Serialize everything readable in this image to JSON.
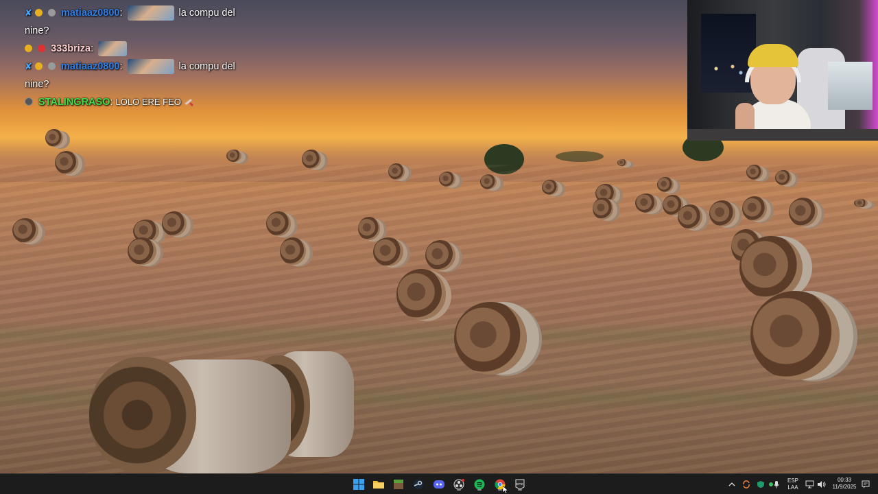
{
  "chat": {
    "lines": [
      {
        "user": "333briza",
        "message": "",
        "user_color": "#ffd0d0"
      },
      {
        "user": "matiaaz0800",
        "message": "la compu del",
        "continuation": "nine?",
        "user_color": "#2f7fe8"
      },
      {
        "user": "333briza",
        "message": "",
        "user_color": "#ffd0d0"
      },
      {
        "user": "matiaaz0800",
        "message": "la compu del",
        "continuation": "nine?",
        "user_color": "#2f7fe8"
      },
      {
        "user": "STALINGRASO",
        "message": "LOLO ERE FEO",
        "user_color": "#3ee04a"
      }
    ],
    "separator": ":"
  },
  "taskbar": {
    "apps": [
      {
        "name": "start-button",
        "icon": "windows-icon"
      },
      {
        "name": "file-explorer",
        "icon": "folder-icon"
      },
      {
        "name": "minecraft",
        "icon": "grass-block-icon"
      },
      {
        "name": "steam",
        "icon": "steam-icon"
      },
      {
        "name": "discord",
        "icon": "discord-icon"
      },
      {
        "name": "obs",
        "icon": "obs-icon"
      },
      {
        "name": "spotify",
        "icon": "spotify-icon"
      },
      {
        "name": "chrome",
        "icon": "chrome-icon"
      },
      {
        "name": "epic-games",
        "icon": "epic-games-icon"
      }
    ],
    "tray": {
      "language_top": "ESP",
      "language_bottom": "LAA",
      "time": "00:33",
      "date": "11/9/2025"
    }
  },
  "colors": {
    "accent_blue": "#2f7fe8",
    "taskbar_bg": "#1c1c1c"
  }
}
